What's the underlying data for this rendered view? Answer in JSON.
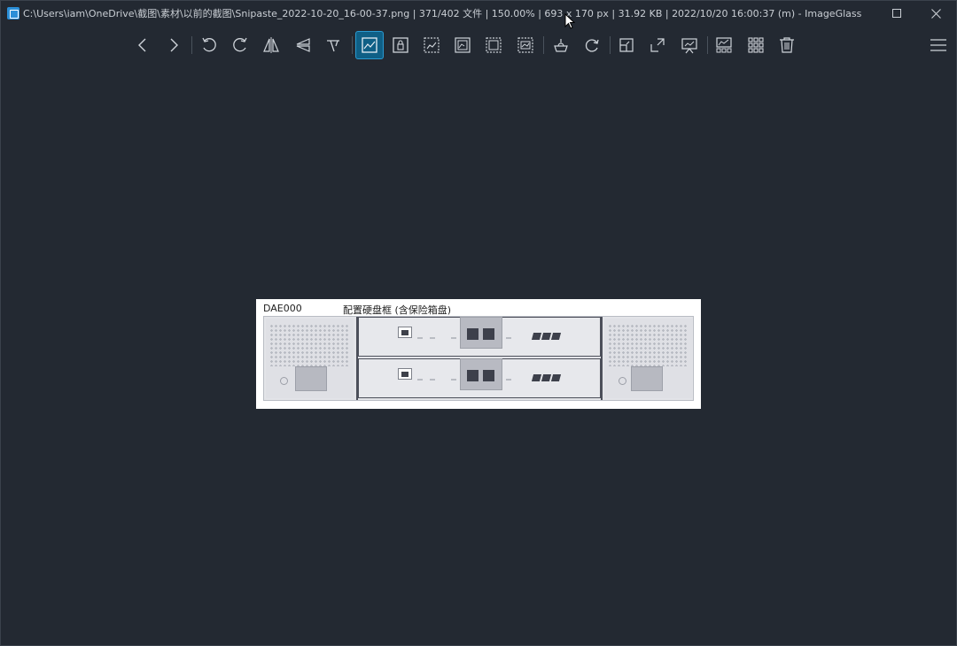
{
  "titlebar": {
    "title": "C:\\Users\\iam\\OneDrive\\截图\\素材\\以前的截图\\Snipaste_2022-10-20_16-00-37.png  |  371/402 文件  |  150.00%  |  693 x 170 px  |  31.92 KB  |  2022/10/20 16:00:37 (m)  - ImageGlass",
    "app_icon": "imageglass-app-icon"
  },
  "window_controls": [
    "maximize-icon",
    "close-icon"
  ],
  "toolbar": {
    "groups": [
      [
        "previous-image",
        "next-image"
      ],
      [
        "rotate-left",
        "rotate-right",
        "flip-horizontal",
        "flip-vertical",
        "crop"
      ],
      [
        "auto-zoom",
        "lock-zoom",
        "scale-to-width",
        "scale-to-height",
        "scale-to-fit",
        "scale-to-fill"
      ],
      [
        "view-channels",
        "refresh"
      ],
      [
        "actual-size",
        "full-screen",
        "slideshow"
      ],
      [
        "thumbnail-bar",
        "gallery",
        "delete"
      ]
    ],
    "active_tool": "auto-zoom",
    "menu_icon": "hamburger-menu-icon"
  },
  "image": {
    "label_left": "DAE000",
    "label_center": "配置硬盘框 (含保险箱盘)"
  },
  "colors": {
    "background": "#232932",
    "active_button": "#0f5f86",
    "titlebar_text": "#c9ced4"
  }
}
